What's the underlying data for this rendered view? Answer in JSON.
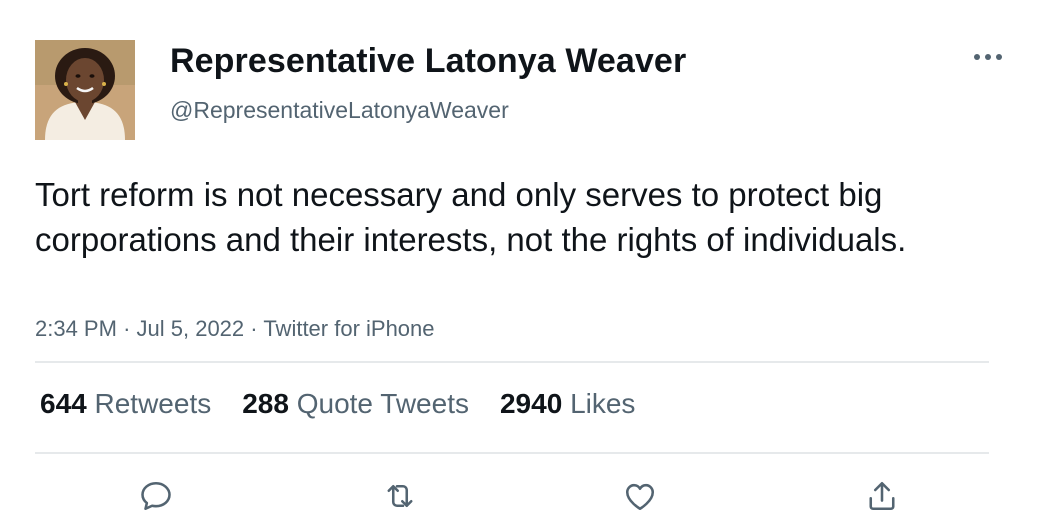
{
  "author": {
    "display_name": "Representative Latonya Weaver",
    "handle": "@RepresentativeLatonyaWeaver",
    "avatar_icon": "profile-photo"
  },
  "tweet": {
    "text": "Tort reform is not necessary and only serves to protect big corporations and their interests, not the rights of individuals.",
    "time": "2:34 PM",
    "date": "Jul 5, 2022",
    "source": "Twitter for iPhone",
    "separator": "·"
  },
  "stats": {
    "retweets_count": "644",
    "retweets_label": "Retweets",
    "quote_tweets_count": "288",
    "quote_tweets_label": "Quote Tweets",
    "likes_count": "2940",
    "likes_label": "Likes"
  },
  "actions": {
    "reply_icon": "reply-icon",
    "retweet_icon": "retweet-icon",
    "like_icon": "heart-icon",
    "share_icon": "share-icon",
    "more_icon": "more-horizontal-icon"
  },
  "colors": {
    "text_primary": "#0f1419",
    "text_secondary": "#536471",
    "divider": "#e6e9eb"
  }
}
